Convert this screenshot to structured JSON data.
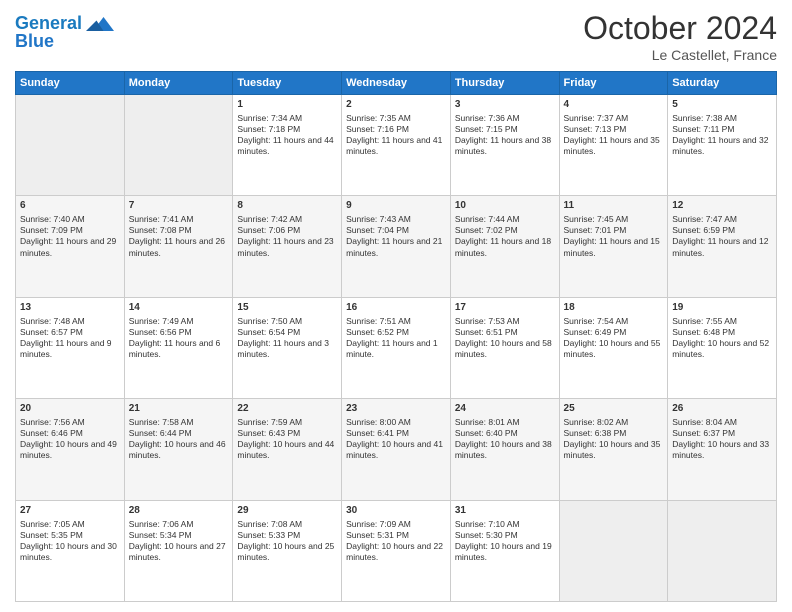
{
  "header": {
    "logo_line1": "General",
    "logo_line2": "Blue",
    "month": "October 2024",
    "location": "Le Castellet, France"
  },
  "days_of_week": [
    "Sunday",
    "Monday",
    "Tuesday",
    "Wednesday",
    "Thursday",
    "Friday",
    "Saturday"
  ],
  "weeks": [
    [
      {
        "day": "",
        "sunrise": "",
        "sunset": "",
        "daylight": ""
      },
      {
        "day": "",
        "sunrise": "",
        "sunset": "",
        "daylight": ""
      },
      {
        "day": "1",
        "sunrise": "Sunrise: 7:34 AM",
        "sunset": "Sunset: 7:18 PM",
        "daylight": "Daylight: 11 hours and 44 minutes."
      },
      {
        "day": "2",
        "sunrise": "Sunrise: 7:35 AM",
        "sunset": "Sunset: 7:16 PM",
        "daylight": "Daylight: 11 hours and 41 minutes."
      },
      {
        "day": "3",
        "sunrise": "Sunrise: 7:36 AM",
        "sunset": "Sunset: 7:15 PM",
        "daylight": "Daylight: 11 hours and 38 minutes."
      },
      {
        "day": "4",
        "sunrise": "Sunrise: 7:37 AM",
        "sunset": "Sunset: 7:13 PM",
        "daylight": "Daylight: 11 hours and 35 minutes."
      },
      {
        "day": "5",
        "sunrise": "Sunrise: 7:38 AM",
        "sunset": "Sunset: 7:11 PM",
        "daylight": "Daylight: 11 hours and 32 minutes."
      }
    ],
    [
      {
        "day": "6",
        "sunrise": "Sunrise: 7:40 AM",
        "sunset": "Sunset: 7:09 PM",
        "daylight": "Daylight: 11 hours and 29 minutes."
      },
      {
        "day": "7",
        "sunrise": "Sunrise: 7:41 AM",
        "sunset": "Sunset: 7:08 PM",
        "daylight": "Daylight: 11 hours and 26 minutes."
      },
      {
        "day": "8",
        "sunrise": "Sunrise: 7:42 AM",
        "sunset": "Sunset: 7:06 PM",
        "daylight": "Daylight: 11 hours and 23 minutes."
      },
      {
        "day": "9",
        "sunrise": "Sunrise: 7:43 AM",
        "sunset": "Sunset: 7:04 PM",
        "daylight": "Daylight: 11 hours and 21 minutes."
      },
      {
        "day": "10",
        "sunrise": "Sunrise: 7:44 AM",
        "sunset": "Sunset: 7:02 PM",
        "daylight": "Daylight: 11 hours and 18 minutes."
      },
      {
        "day": "11",
        "sunrise": "Sunrise: 7:45 AM",
        "sunset": "Sunset: 7:01 PM",
        "daylight": "Daylight: 11 hours and 15 minutes."
      },
      {
        "day": "12",
        "sunrise": "Sunrise: 7:47 AM",
        "sunset": "Sunset: 6:59 PM",
        "daylight": "Daylight: 11 hours and 12 minutes."
      }
    ],
    [
      {
        "day": "13",
        "sunrise": "Sunrise: 7:48 AM",
        "sunset": "Sunset: 6:57 PM",
        "daylight": "Daylight: 11 hours and 9 minutes."
      },
      {
        "day": "14",
        "sunrise": "Sunrise: 7:49 AM",
        "sunset": "Sunset: 6:56 PM",
        "daylight": "Daylight: 11 hours and 6 minutes."
      },
      {
        "day": "15",
        "sunrise": "Sunrise: 7:50 AM",
        "sunset": "Sunset: 6:54 PM",
        "daylight": "Daylight: 11 hours and 3 minutes."
      },
      {
        "day": "16",
        "sunrise": "Sunrise: 7:51 AM",
        "sunset": "Sunset: 6:52 PM",
        "daylight": "Daylight: 11 hours and 1 minute."
      },
      {
        "day": "17",
        "sunrise": "Sunrise: 7:53 AM",
        "sunset": "Sunset: 6:51 PM",
        "daylight": "Daylight: 10 hours and 58 minutes."
      },
      {
        "day": "18",
        "sunrise": "Sunrise: 7:54 AM",
        "sunset": "Sunset: 6:49 PM",
        "daylight": "Daylight: 10 hours and 55 minutes."
      },
      {
        "day": "19",
        "sunrise": "Sunrise: 7:55 AM",
        "sunset": "Sunset: 6:48 PM",
        "daylight": "Daylight: 10 hours and 52 minutes."
      }
    ],
    [
      {
        "day": "20",
        "sunrise": "Sunrise: 7:56 AM",
        "sunset": "Sunset: 6:46 PM",
        "daylight": "Daylight: 10 hours and 49 minutes."
      },
      {
        "day": "21",
        "sunrise": "Sunrise: 7:58 AM",
        "sunset": "Sunset: 6:44 PM",
        "daylight": "Daylight: 10 hours and 46 minutes."
      },
      {
        "day": "22",
        "sunrise": "Sunrise: 7:59 AM",
        "sunset": "Sunset: 6:43 PM",
        "daylight": "Daylight: 10 hours and 44 minutes."
      },
      {
        "day": "23",
        "sunrise": "Sunrise: 8:00 AM",
        "sunset": "Sunset: 6:41 PM",
        "daylight": "Daylight: 10 hours and 41 minutes."
      },
      {
        "day": "24",
        "sunrise": "Sunrise: 8:01 AM",
        "sunset": "Sunset: 6:40 PM",
        "daylight": "Daylight: 10 hours and 38 minutes."
      },
      {
        "day": "25",
        "sunrise": "Sunrise: 8:02 AM",
        "sunset": "Sunset: 6:38 PM",
        "daylight": "Daylight: 10 hours and 35 minutes."
      },
      {
        "day": "26",
        "sunrise": "Sunrise: 8:04 AM",
        "sunset": "Sunset: 6:37 PM",
        "daylight": "Daylight: 10 hours and 33 minutes."
      }
    ],
    [
      {
        "day": "27",
        "sunrise": "Sunrise: 7:05 AM",
        "sunset": "Sunset: 5:35 PM",
        "daylight": "Daylight: 10 hours and 30 minutes."
      },
      {
        "day": "28",
        "sunrise": "Sunrise: 7:06 AM",
        "sunset": "Sunset: 5:34 PM",
        "daylight": "Daylight: 10 hours and 27 minutes."
      },
      {
        "day": "29",
        "sunrise": "Sunrise: 7:08 AM",
        "sunset": "Sunset: 5:33 PM",
        "daylight": "Daylight: 10 hours and 25 minutes."
      },
      {
        "day": "30",
        "sunrise": "Sunrise: 7:09 AM",
        "sunset": "Sunset: 5:31 PM",
        "daylight": "Daylight: 10 hours and 22 minutes."
      },
      {
        "day": "31",
        "sunrise": "Sunrise: 7:10 AM",
        "sunset": "Sunset: 5:30 PM",
        "daylight": "Daylight: 10 hours and 19 minutes."
      },
      {
        "day": "",
        "sunrise": "",
        "sunset": "",
        "daylight": ""
      },
      {
        "day": "",
        "sunrise": "",
        "sunset": "",
        "daylight": ""
      }
    ]
  ]
}
